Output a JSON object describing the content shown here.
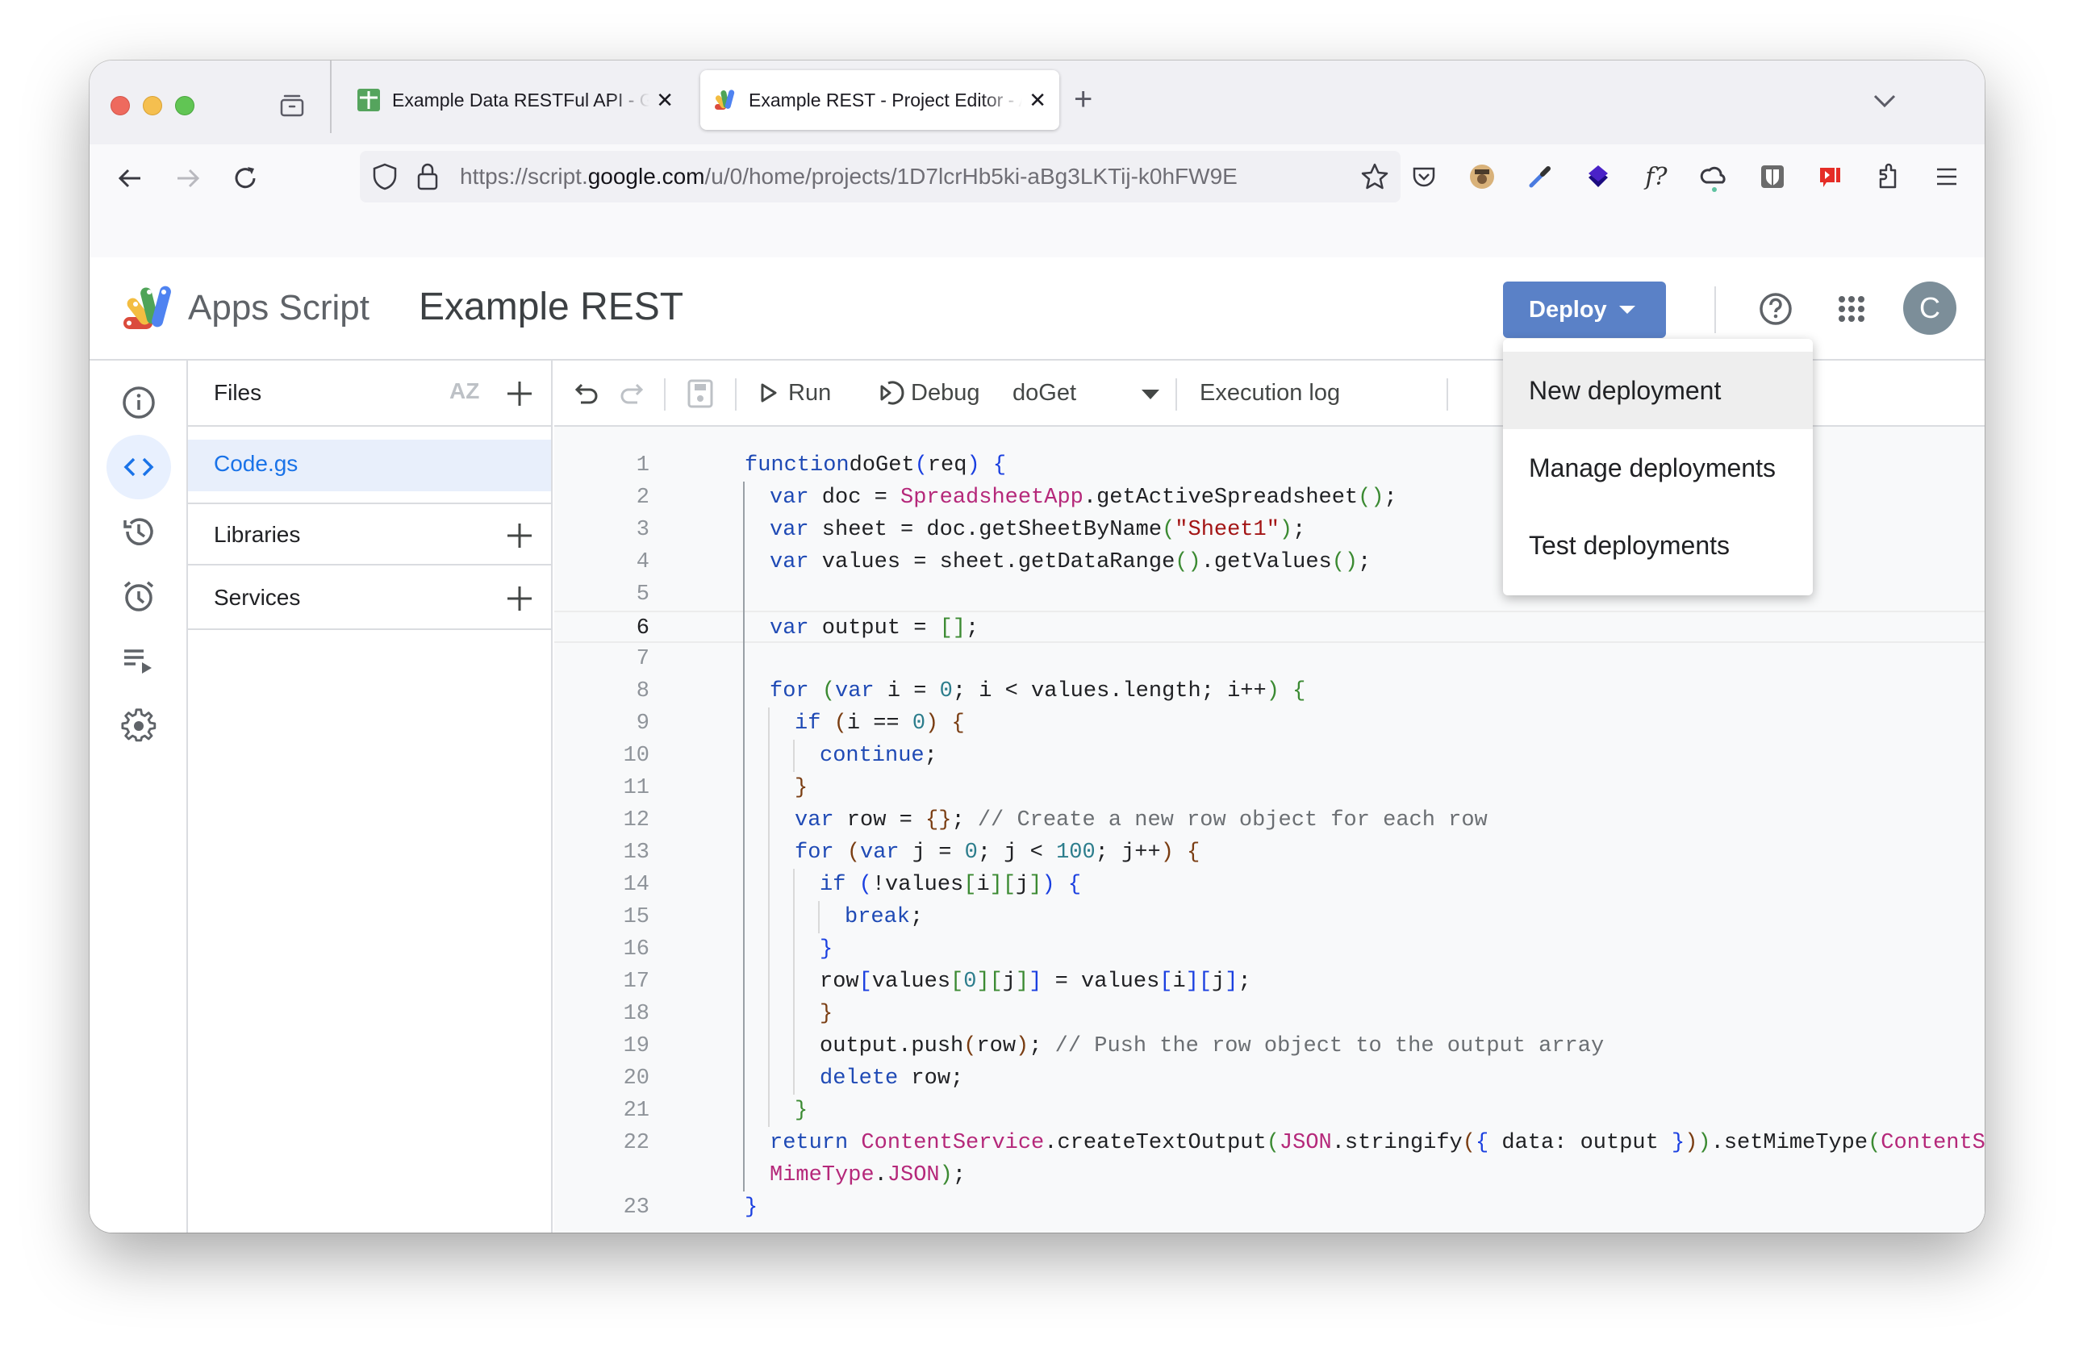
{
  "browser": {
    "tabs": [
      {
        "title": "Example Data RESTFul API - Google Sheets",
        "favicon": "google-sheets-icon",
        "active": false
      },
      {
        "title": "Example REST - Project Editor - Apps Script",
        "favicon": "apps-script-icon",
        "active": true
      }
    ],
    "new_tab_label": "+",
    "close_glyph": "✕",
    "url": {
      "prefix": "https://script.",
      "domain": "google.com",
      "path": "/u/0/home/projects/1D7lcrHb5ki-aBg3LKTij-k0hFW9E"
    },
    "extensions": [
      "pocket-icon",
      "user-avatar-extension-icon",
      "eyedropper-icon",
      "layers-extension-icon",
      "formula-extension-icon",
      "cloud-sync-icon",
      "bitwarden-icon",
      "youtube-extension-icon",
      "extensions-puzzle-icon",
      "menu-icon"
    ],
    "formula_ext_label": "f?"
  },
  "app": {
    "name": "Apps Script",
    "project": "Example REST",
    "deploy_label": "Deploy",
    "avatar_initial": "C",
    "deploy_menu": [
      {
        "label": "New deployment",
        "highlighted": true
      },
      {
        "label": "Manage deployments",
        "highlighted": false
      },
      {
        "label": "Test deployments",
        "highlighted": false
      }
    ]
  },
  "rail": [
    "overview-info-icon",
    "editor-code-icon",
    "triggers-history-icon",
    "triggers-alarm-icon",
    "executions-icon",
    "settings-gear-icon"
  ],
  "files_panel": {
    "files_label": "Files",
    "sort_label": "AZ",
    "files": [
      "Code.gs"
    ],
    "libraries_label": "Libraries",
    "services_label": "Services"
  },
  "toolbar": {
    "run_label": "Run",
    "debug_label": "Debug",
    "function_select": "doGet",
    "exec_log_label": "Execution log"
  },
  "editor": {
    "current_line": 6,
    "lines": [
      {
        "n": "1",
        "indent": 0,
        "code": [
          [
            "kw",
            "function"
          ],
          [
            "",
            "doGet"
          ],
          [
            "p3",
            "("
          ],
          [
            "",
            "req"
          ],
          [
            "p3",
            ")"
          ],
          [
            "",
            " "
          ],
          [
            "p3",
            "{"
          ]
        ]
      },
      {
        "n": "2",
        "indent": 1,
        "code": [
          [
            "kw",
            "var"
          ],
          [
            "",
            " doc = "
          ],
          [
            "cls",
            "SpreadsheetApp"
          ],
          [
            "",
            ".getActiveSpreadsheet"
          ],
          [
            "p1",
            "()"
          ],
          [
            "",
            ";"
          ]
        ]
      },
      {
        "n": "3",
        "indent": 1,
        "code": [
          [
            "kw",
            "var"
          ],
          [
            "",
            " sheet = doc.getSheetByName"
          ],
          [
            "p1",
            "("
          ],
          [
            "str",
            "\"Sheet1\""
          ],
          [
            "p1",
            ")"
          ],
          [
            "",
            ";"
          ]
        ]
      },
      {
        "n": "4",
        "indent": 1,
        "code": [
          [
            "kw",
            "var"
          ],
          [
            "",
            " values = sheet.getDataRange"
          ],
          [
            "p1",
            "()"
          ],
          [
            "",
            ".getValues"
          ],
          [
            "p1",
            "()"
          ],
          [
            "",
            ";"
          ]
        ]
      },
      {
        "n": "5",
        "indent": 1,
        "code": []
      },
      {
        "n": "6",
        "indent": 1,
        "code": [
          [
            "kw",
            "var"
          ],
          [
            "",
            " output = "
          ],
          [
            "p1",
            "[]"
          ],
          [
            "",
            ";"
          ]
        ]
      },
      {
        "n": "7",
        "indent": 1,
        "code": []
      },
      {
        "n": "8",
        "indent": 1,
        "code": [
          [
            "kw",
            "for"
          ],
          [
            "",
            " "
          ],
          [
            "p1",
            "("
          ],
          [
            "kw",
            "var"
          ],
          [
            "",
            " i = "
          ],
          [
            "num",
            "0"
          ],
          [
            "",
            "; i < values.length; i++"
          ],
          [
            "p1",
            ")"
          ],
          [
            "",
            " "
          ],
          [
            "p1",
            "{"
          ]
        ]
      },
      {
        "n": "9",
        "indent": 2,
        "code": [
          [
            "kw",
            "if"
          ],
          [
            "",
            " "
          ],
          [
            "p2",
            "("
          ],
          [
            "",
            "i == "
          ],
          [
            "num",
            "0"
          ],
          [
            "p2",
            ")"
          ],
          [
            "",
            " "
          ],
          [
            "p2",
            "{"
          ]
        ]
      },
      {
        "n": "10",
        "indent": 3,
        "code": [
          [
            "kw",
            "continue"
          ],
          [
            "",
            ";"
          ]
        ]
      },
      {
        "n": "11",
        "indent": 2,
        "code": [
          [
            "p2",
            "}"
          ]
        ]
      },
      {
        "n": "12",
        "indent": 2,
        "code": [
          [
            "kw",
            "var"
          ],
          [
            "",
            " row = "
          ],
          [
            "p2",
            "{}"
          ],
          [
            "",
            "; "
          ],
          [
            "com",
            "// Create a new row object for each row"
          ]
        ]
      },
      {
        "n": "13",
        "indent": 2,
        "code": [
          [
            "kw",
            "for"
          ],
          [
            "",
            " "
          ],
          [
            "p2",
            "("
          ],
          [
            "kw",
            "var"
          ],
          [
            "",
            " j = "
          ],
          [
            "num",
            "0"
          ],
          [
            "",
            "; j < "
          ],
          [
            "num",
            "100"
          ],
          [
            "",
            "; j++"
          ],
          [
            "p2",
            ")"
          ],
          [
            "",
            " "
          ],
          [
            "p2",
            "{"
          ]
        ]
      },
      {
        "n": "14",
        "indent": 3,
        "code": [
          [
            "kw",
            "if"
          ],
          [
            "",
            " "
          ],
          [
            "p3",
            "("
          ],
          [
            "",
            "!values"
          ],
          [
            "p1",
            "["
          ],
          [
            "",
            "i"
          ],
          [
            "p1",
            "]["
          ],
          [
            "",
            "j"
          ],
          [
            "p1",
            "]"
          ],
          [
            "p3",
            ")"
          ],
          [
            "",
            " "
          ],
          [
            "p3",
            "{"
          ]
        ]
      },
      {
        "n": "15",
        "indent": 4,
        "code": [
          [
            "kw",
            "break"
          ],
          [
            "",
            ";"
          ]
        ]
      },
      {
        "n": "16",
        "indent": 3,
        "code": [
          [
            "p3",
            "}"
          ]
        ]
      },
      {
        "n": "17",
        "indent": 3,
        "code": [
          [
            "",
            "row"
          ],
          [
            "p3",
            "["
          ],
          [
            "",
            "values"
          ],
          [
            "p1",
            "["
          ],
          [
            "num",
            "0"
          ],
          [
            "p1",
            "]["
          ],
          [
            "",
            "j"
          ],
          [
            "p1",
            "]"
          ],
          [
            "p3",
            "]"
          ],
          [
            "",
            " = values"
          ],
          [
            "p3",
            "["
          ],
          [
            "",
            "i"
          ],
          [
            "p3",
            "]["
          ],
          [
            "",
            "j"
          ],
          [
            "p3",
            "]"
          ],
          [
            "",
            ";"
          ]
        ]
      },
      {
        "n": "18",
        "indent": 3,
        "code": [
          [
            "p2",
            "}"
          ]
        ]
      },
      {
        "n": "19",
        "indent": 3,
        "code": [
          [
            "",
            "output.push"
          ],
          [
            "p2",
            "("
          ],
          [
            "",
            "row"
          ],
          [
            "p2",
            ")"
          ],
          [
            "",
            "; "
          ],
          [
            "com",
            "// Push the row object to the output array"
          ]
        ]
      },
      {
        "n": "20",
        "indent": 3,
        "code": [
          [
            "kw",
            "delete"
          ],
          [
            "",
            " row;"
          ]
        ]
      },
      {
        "n": "21",
        "indent": 2,
        "code": [
          [
            "p1",
            "}"
          ]
        ]
      },
      {
        "n": "22",
        "indent": 1,
        "code": [
          [
            "kw",
            "return"
          ],
          [
            "",
            " "
          ],
          [
            "cls",
            "ContentService"
          ],
          [
            "",
            ".createTextOutput"
          ],
          [
            "p1",
            "("
          ],
          [
            "cls",
            "JSON"
          ],
          [
            "",
            ".stringify"
          ],
          [
            "p2",
            "("
          ],
          [
            "p3",
            "{"
          ],
          [
            "",
            " data: output "
          ],
          [
            "p3",
            "}"
          ],
          [
            "p2",
            ")"
          ],
          [
            "p1",
            ")"
          ],
          [
            "",
            ".setMimeType"
          ],
          [
            "p1",
            "("
          ],
          [
            "cls",
            "ContentService"
          ],
          [
            "",
            "."
          ]
        ]
      },
      {
        "n": "",
        "indent": 1,
        "code": [
          [
            "cls",
            "MimeType"
          ],
          [
            "",
            "."
          ],
          [
            "cls",
            "JSON"
          ],
          [
            "p1",
            ")"
          ],
          [
            "",
            ";"
          ]
        ]
      },
      {
        "n": "23",
        "indent": 0,
        "code": [
          [
            "p3",
            "}"
          ]
        ]
      }
    ]
  }
}
